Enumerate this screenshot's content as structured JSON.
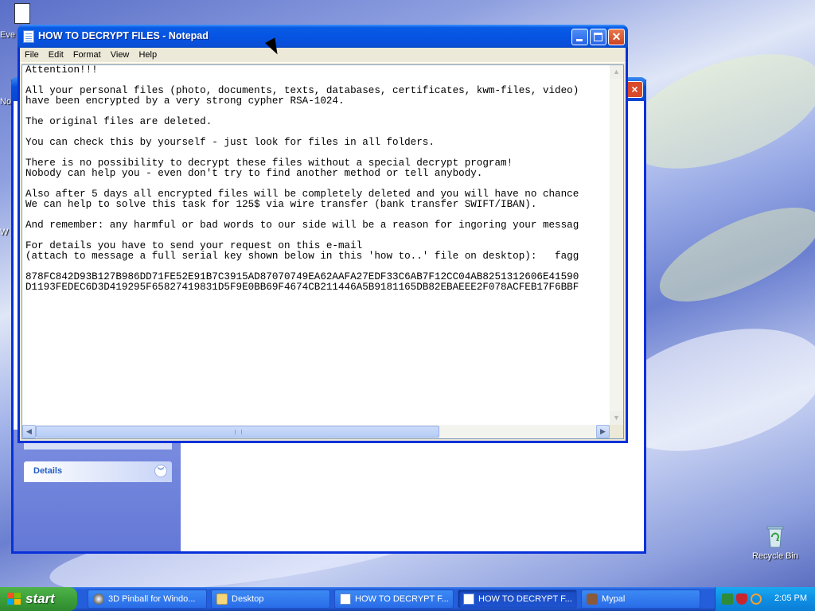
{
  "desktop": {
    "recycle_bin_label": "Recycle Bin",
    "partial_icon_label_1": "Eve",
    "partial_icon_label_2": "No",
    "partial_icon_label_3": "W"
  },
  "background_window": {
    "details_panel_label": "Details"
  },
  "notepad": {
    "title": "HOW TO DECRYPT FILES - Notepad",
    "menu": [
      "File",
      "Edit",
      "Format",
      "View",
      "Help"
    ],
    "content": "Attention!!!\n\nAll your personal files (photo, documents, texts, databases, certificates, kwm-files, video)\nhave been encrypted by a very strong cypher RSA-1024.\n\nThe original files are deleted.\n\nYou can check this by yourself - just look for files in all folders.\n\nThere is no possibility to decrypt these files without a special decrypt program!\nNobody can help you - even don't try to find another method or tell anybody.\n\nAlso after 5 days all encrypted files will be completely deleted and you will have no chance\nWe can help to solve this task for 125$ via wire transfer (bank transfer SWIFT/IBAN).\n\nAnd remember: any harmful or bad words to our side will be a reason for ingoring your messag\n\nFor details you have to send your request on this e-mail\n(attach to message a full serial key shown below in this 'how to..' file on desktop):   fagg\n\n878FC842D93B127B986DD71FE52E91B7C3915AD87070749EA62AAFA27EDF33C6AB7F12CC04AB8251312606E41590\nD1193FEDEC6D3D419295F65827419831D5F9E0BB69F4674CB211446A5B9181165DB82EBAEEE2F078ACFEB17F6BBF"
  },
  "taskbar": {
    "start_label": "start",
    "buttons": [
      {
        "label": "3D Pinball for Windo...",
        "icon": "pinball-icon",
        "active": false
      },
      {
        "label": "Desktop",
        "icon": "folder-icon",
        "active": false
      },
      {
        "label": "HOW TO DECRYPT F...",
        "icon": "notepad-icon",
        "active": false
      },
      {
        "label": "HOW TO DECRYPT F...",
        "icon": "notepad-icon",
        "active": true
      },
      {
        "label": "Mypal",
        "icon": "mypal-icon",
        "active": false
      }
    ],
    "clock": "2:05 PM"
  },
  "colors": {
    "title_bar": "#0a5ce5",
    "taskbar": "#245edb",
    "start_button": "#3c9f3a",
    "tray": "#0f8fe4"
  }
}
